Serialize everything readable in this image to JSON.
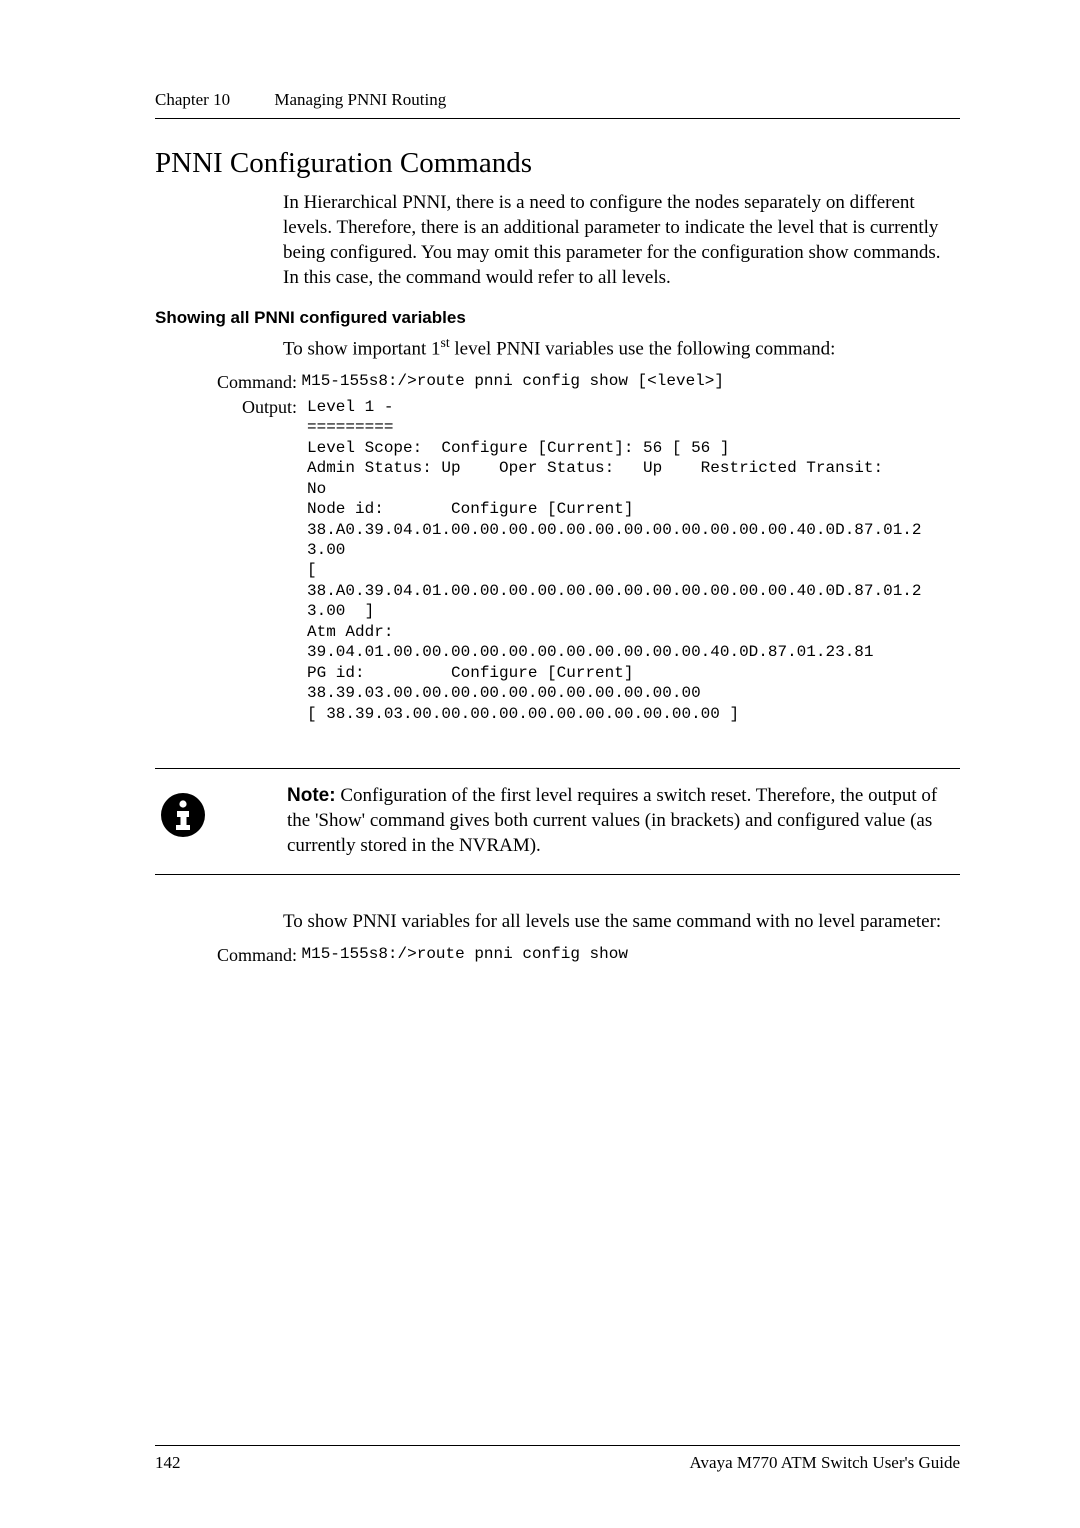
{
  "header": {
    "chapter_label": "Chapter 10",
    "chapter_title": "Managing PNNI Routing"
  },
  "section_title": "PNNI Configuration Commands",
  "intro_paragraph": "In Hierarchical PNNI, there is a need to configure the nodes separately on different levels. Therefore, there is an additional parameter to indicate the level that is currently being configured. You may omit this parameter for the configuration show commands. In this case, the command would refer to all levels.",
  "subhead1": "Showing all PNNI configured variables",
  "show_line_pre": "To show important 1",
  "show_line_sup": "st",
  "show_line_post": " level PNNI variables use the following command:",
  "command_label": "Command:",
  "output_label": "Output:",
  "command1": "M15-155s8:/>route pnni config show [<level>]",
  "output1": "Level 1 -\n=========\nLevel Scope:  Configure [Current]: 56 [ 56 ]\nAdmin Status: Up    Oper Status:   Up    Restricted Transit:    \nNo\nNode id:       Configure [Current]\n38.A0.39.04.01.00.00.00.00.00.00.00.00.00.00.00.00.40.0D.87.01.2\n3.00\n[ \n38.A0.39.04.01.00.00.00.00.00.00.00.00.00.00.00.00.40.0D.87.01.2\n3.00  ]\nAtm Addr:      \n39.04.01.00.00.00.00.00.00.00.00.00.00.00.40.0D.87.01.23.81\nPG id:         Configure [Current]\n38.39.03.00.00.00.00.00.00.00.00.00.00.00\n[ 38.39.03.00.00.00.00.00.00.00.00.00.00.00 ]",
  "note_label": "Note:",
  "note_text": "Configuration of the first level requires a switch reset. Therefore, the output of the 'Show' command gives both current values (in brackets) and configured value (as currently stored in the NVRAM).",
  "para2": "To show PNNI variables for all levels use the same command with no level parameter:",
  "command2": "M15-155s8:/>route pnni config show",
  "footer": {
    "page_number": "142",
    "doc_title": "Avaya M770 ATM Switch User's Guide"
  }
}
